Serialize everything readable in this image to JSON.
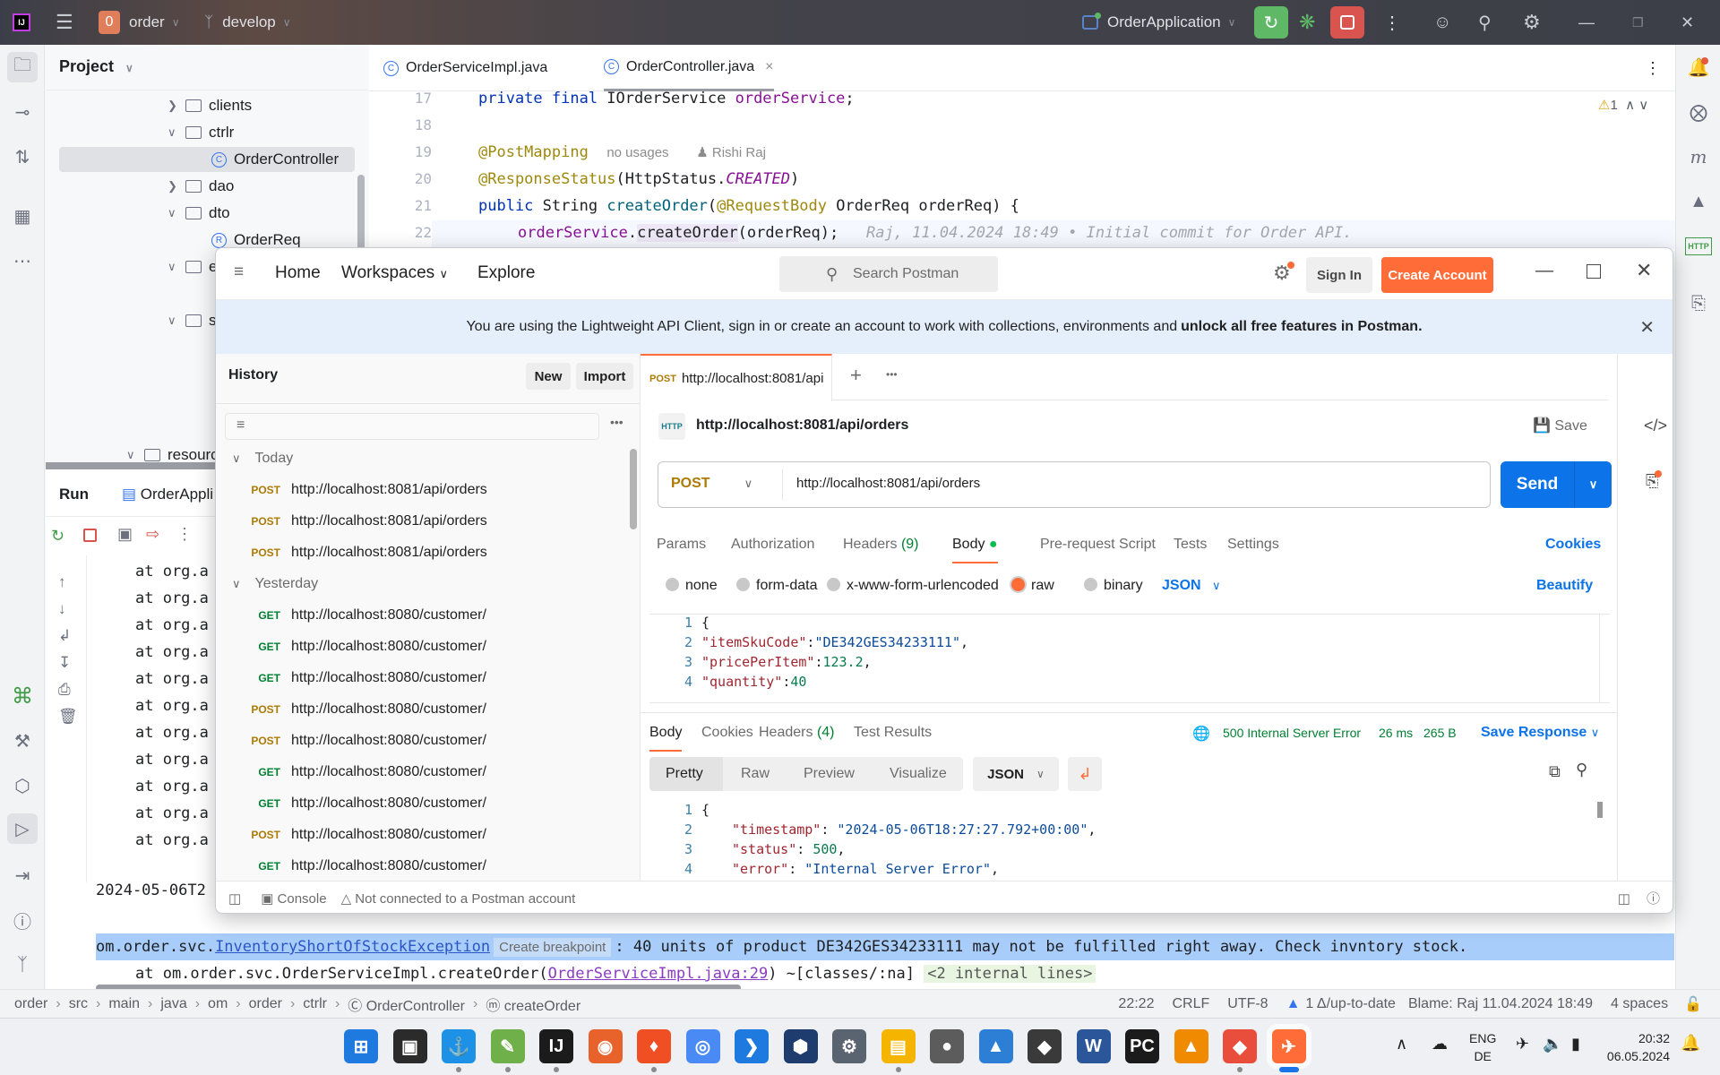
{
  "ide": {
    "project_badge": "0",
    "project_name": "order",
    "branch": "develop",
    "run_config": "OrderApplication",
    "project_panel_title": "Project",
    "tree": [
      {
        "label": "clients",
        "type": "folder",
        "expanded": false
      },
      {
        "label": "ctrlr",
        "type": "folder",
        "expanded": true
      },
      {
        "label": "OrderController",
        "type": "class",
        "selected": true
      },
      {
        "label": "dao",
        "type": "folder",
        "expanded": false
      },
      {
        "label": "dto",
        "type": "folder",
        "expanded": true
      },
      {
        "label": "OrderReq",
        "type": "record"
      },
      {
        "label": "e",
        "type": "folder",
        "expanded": true
      },
      {
        "label": "s",
        "type": "folder",
        "expanded": true
      },
      {
        "label": "resourc",
        "type": "folder",
        "expanded": true
      }
    ],
    "editor_tabs": [
      {
        "label": "OrderServiceImpl.java",
        "active": false
      },
      {
        "label": "OrderController.java",
        "active": true
      }
    ],
    "code_lines": [
      {
        "num": "17",
        "text": "private final IOrderService orderService;"
      },
      {
        "num": "18",
        "text": ""
      },
      {
        "num": "19",
        "text": "@PostMapping",
        "hint": "no usages",
        "author": "Rishi Raj"
      },
      {
        "num": "20",
        "text": "@ResponseStatus(HttpStatus.CREATED)"
      },
      {
        "num": "21",
        "text": "public String createOrder(@RequestBody OrderReq orderReq) {"
      },
      {
        "num": "22",
        "text": "orderService.createOrder(orderReq);",
        "blame": "Raj, 11.04.2024 18:49 • Initial commit for Order API."
      }
    ],
    "warning_count": "1",
    "run_tab_label": "Run",
    "run_config_tab": "OrderAppli",
    "console_lines": [
      "at org.a",
      "at org.a",
      "at org.a",
      "at org.a",
      "at org.a",
      "at org.a",
      "at org.a",
      "at org.a",
      "at org.a",
      "at org.a",
      "at org.a"
    ],
    "console_timestamp": "2024-05-06T2",
    "exception": {
      "package": "om.order.svc.",
      "class": "InventoryShortOfStockException",
      "breakpoint_hint": "Create breakpoint",
      "message": ": 40 units of product DE342GES34233111 may not be fulfilled right away. Check invntory stock."
    },
    "stack_line": {
      "prefix": "at om.order.svc.OrderServiceImpl.createOrder(",
      "link": "OrderServiceImpl.java:29",
      "suffix": ") ~[classes/:na]",
      "internal": "<2 internal lines>"
    },
    "breadcrumb": [
      "order",
      "src",
      "main",
      "java",
      "om",
      "order",
      "ctrlr",
      "OrderController",
      "createOrder"
    ],
    "status": {
      "position": "22:22",
      "line_sep": "CRLF",
      "encoding": "UTF-8",
      "vcs": "1 Δ/up-to-date",
      "blame": "Blame: Raj 11.04.2024 18:49",
      "indent": "4 spaces"
    }
  },
  "postman": {
    "nav": {
      "home": "Home",
      "workspaces": "Workspaces",
      "explore": "Explore"
    },
    "search_placeholder": "Search Postman",
    "sign_in": "Sign In",
    "create_account": "Create Account",
    "banner_text": "You are using the Lightweight API Client, sign in or create an account to work with collections, environments and ",
    "banner_bold": "unlock all free features in Postman.",
    "sidebar": {
      "title": "History",
      "new_label": "New",
      "import_label": "Import",
      "groups": [
        {
          "label": "Today",
          "items": [
            {
              "method": "POST",
              "url": "http://localhost:8081/api/orders"
            },
            {
              "method": "POST",
              "url": "http://localhost:8081/api/orders"
            },
            {
              "method": "POST",
              "url": "http://localhost:8081/api/orders"
            }
          ]
        },
        {
          "label": "Yesterday",
          "items": [
            {
              "method": "GET",
              "url": "http://localhost:8080/customer/"
            },
            {
              "method": "GET",
              "url": "http://localhost:8080/customer/"
            },
            {
              "method": "GET",
              "url": "http://localhost:8080/customer/"
            },
            {
              "method": "POST",
              "url": "http://localhost:8080/customer/"
            },
            {
              "method": "POST",
              "url": "http://localhost:8080/customer/"
            },
            {
              "method": "GET",
              "url": "http://localhost:8080/customer/"
            },
            {
              "method": "GET",
              "url": "http://localhost:8080/customer/"
            },
            {
              "method": "POST",
              "url": "http://localhost:8080/customer/"
            },
            {
              "method": "GET",
              "url": "http://localhost:8080/customer/"
            }
          ]
        }
      ]
    },
    "request_tab": {
      "method": "POST",
      "label": "http://localhost:8081/api"
    },
    "request_title": "http://localhost:8081/api/orders",
    "save_label": "Save",
    "method": "POST",
    "url": "http://localhost:8081/api/orders",
    "send_label": "Send",
    "req_tabs": [
      "Params",
      "Authorization",
      "Headers",
      "Body",
      "Pre-request Script",
      "Tests",
      "Settings"
    ],
    "headers_count": "(9)",
    "cookies_label": "Cookies",
    "body_types": [
      "none",
      "form-data",
      "x-www-form-urlencoded",
      "raw",
      "binary"
    ],
    "body_format": "JSON",
    "beautify_label": "Beautify",
    "request_body": [
      {
        "n": "1",
        "text": "{"
      },
      {
        "n": "2",
        "key": "\"itemSkuCode\"",
        "val": "\"DE342GES34233111\"",
        "type": "string",
        "trail": ","
      },
      {
        "n": "3",
        "key": "\"pricePerItem\"",
        "val": "123.2",
        "type": "number",
        "trail": ","
      },
      {
        "n": "4",
        "key": "\"quantity\"",
        "val": "40",
        "type": "number",
        "trail": ""
      }
    ],
    "resp_tabs": [
      "Body",
      "Cookies",
      "Headers",
      "Test Results"
    ],
    "resp_headers_count": "(4)",
    "status_text": "500 Internal Server Error",
    "time": "26 ms",
    "size": "265 B",
    "save_response": "Save Response",
    "view_modes": [
      "Pretty",
      "Raw",
      "Preview",
      "Visualize"
    ],
    "resp_format": "JSON",
    "response_body": [
      {
        "n": "1",
        "text": "{"
      },
      {
        "n": "2",
        "key": "\"timestamp\"",
        "val": "\"2024-05-06T18:27:27.792+00:00\"",
        "type": "string",
        "trail": ","
      },
      {
        "n": "3",
        "key": "\"status\"",
        "val": "500",
        "type": "number",
        "trail": ","
      },
      {
        "n": "4",
        "key": "\"error\"",
        "val": "\"Internal Server Error\"",
        "type": "string",
        "trail": ","
      }
    ],
    "footer": {
      "console": "Console",
      "account": "Not connected to a Postman account"
    }
  },
  "taskbar": {
    "apps": [
      "Start",
      "Task View",
      "Docker",
      "Notepad++",
      "IntelliJ IDEA",
      "Firefox",
      "Brave",
      "Chrome",
      "VS Code",
      "VirtualBox",
      "Settings",
      "File Explorer",
      "Recorder",
      "Photos",
      "Inkscape",
      "Word",
      "PyCharm",
      "VLC",
      "Git",
      "Postman"
    ],
    "lang_top": "ENG",
    "lang_bottom": "DE",
    "time": "20:32",
    "date": "06.05.2024"
  }
}
